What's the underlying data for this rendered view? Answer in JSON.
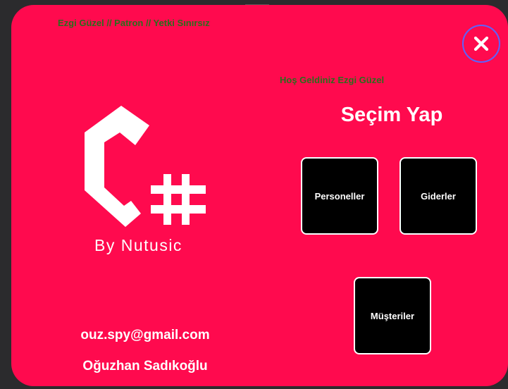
{
  "header": {
    "user_info": "Ezgi Güzel // Patron // Yetki Sınırsız",
    "close_icon": "close-x-icon"
  },
  "welcome": "Hoş Geldiniz Ezgi Güzel",
  "heading": "Seçim Yap",
  "logo": {
    "icon": "csharp-logo-icon",
    "caption": "By Nutusic"
  },
  "menu": {
    "buttons": [
      {
        "label": "Personeller"
      },
      {
        "label": "Giderler"
      },
      {
        "label": "Müşteriler"
      }
    ]
  },
  "footer": {
    "email": "ouz.spy@gmail.com",
    "name": "Oğuzhan Sadıkoğlu"
  },
  "colors": {
    "background": "#ff0a4e",
    "text_green": "#2a6e1c",
    "tile": "#000000",
    "close_ring": "#5b63ff"
  }
}
